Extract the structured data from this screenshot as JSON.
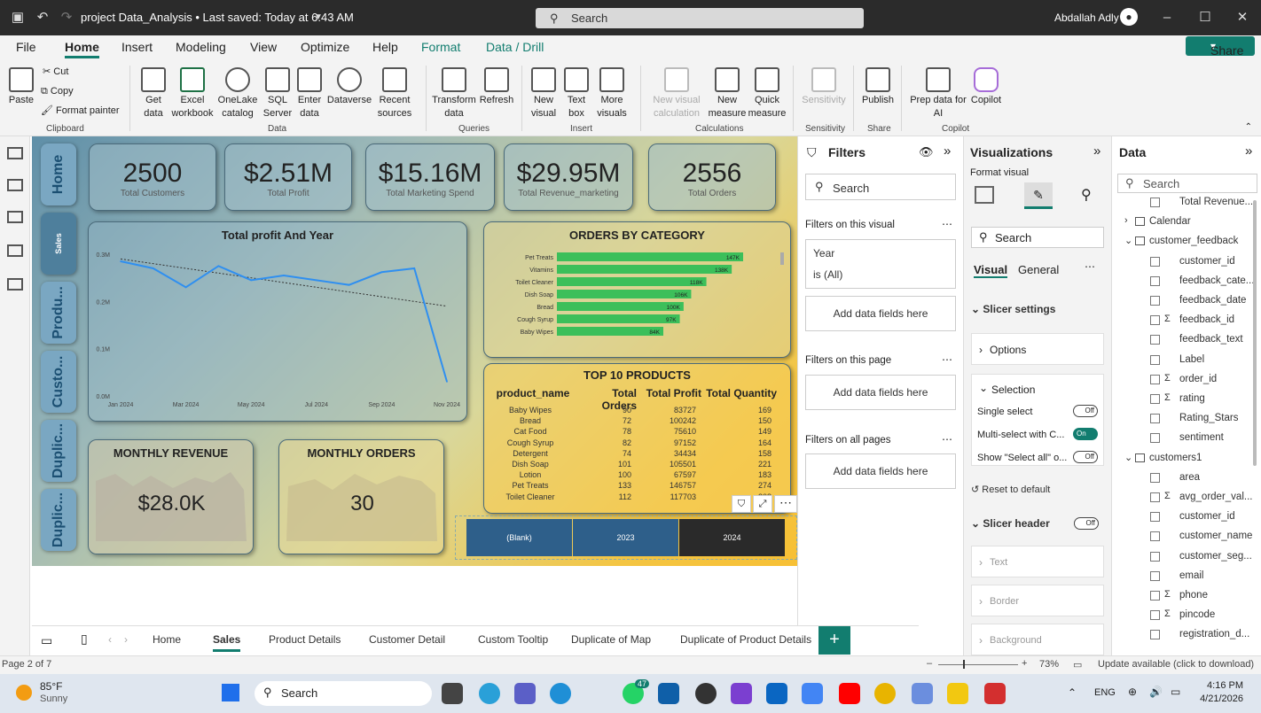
{
  "titlebar": {
    "title": "project Data_Analysis • Last saved: Today at 6:43 AM",
    "search": "Search",
    "user": "Abdallah Adly"
  },
  "menu": [
    "File",
    "Home",
    "Insert",
    "Modeling",
    "View",
    "Optimize",
    "Help",
    "Format",
    "Data / Drill"
  ],
  "share": "Share",
  "ribbon": {
    "clipboard": {
      "paste": "Paste",
      "cut": "Cut",
      "copy": "Copy",
      "format_painter": "Format painter",
      "group": "Clipboard"
    },
    "data": {
      "get_data": "Get data",
      "excel": "Excel workbook",
      "onelake": "OneLake catalog",
      "sql": "SQL Server",
      "enter": "Enter data",
      "dataverse": "Dataverse",
      "recent": "Recent sources",
      "group": "Data"
    },
    "queries": {
      "transform": "Transform data",
      "refresh": "Refresh",
      "group": "Queries"
    },
    "insert": {
      "new_visual": "New visual",
      "text_box": "Text box",
      "more_visuals": "More visuals",
      "group": "Insert"
    },
    "calc": {
      "new_visual_calc": "New visual calculation",
      "new_measure": "New measure",
      "quick_measure": "Quick measure",
      "group": "Calculations"
    },
    "sens": {
      "label": "Sensitivity",
      "group": "Sensitivity"
    },
    "share": {
      "publish": "Publish",
      "group": "Share"
    },
    "copilot": {
      "prep": "Prep data for AI",
      "copilot": "Copilot",
      "group": "Copilot"
    }
  },
  "nav_tabs": [
    "Home",
    "Sales",
    "Produ...",
    "Custo...",
    "Duplic...",
    "Duplic..."
  ],
  "kpis": [
    {
      "value": "2500",
      "label": "Total Customers"
    },
    {
      "value": "$2.51M",
      "label": "Total Profit"
    },
    {
      "value": "$15.16M",
      "label": "Total Marketing Spend"
    },
    {
      "value": "$29.95M",
      "label": "Total Revenue_marketing"
    },
    {
      "value": "2556",
      "label": "Total Orders"
    }
  ],
  "monthly": [
    {
      "title": "MONTHLY REVENUE",
      "value": "$28.0K"
    },
    {
      "title": "MONTHLY ORDERS",
      "value": "30"
    }
  ],
  "chart_data": [
    {
      "type": "line",
      "title": "Total profit And Year",
      "x": [
        "Jan 2024",
        "Feb 2024",
        "Mar 2024",
        "Apr 2024",
        "May 2024",
        "Jun 2024",
        "Jul 2024",
        "Aug 2024",
        "Sep 2024",
        "Oct 2024",
        "Nov 2024"
      ],
      "x_tick_labels": [
        "Jan 2024",
        "Mar 2024",
        "May 2024",
        "Jul 2024",
        "Sep 2024",
        "Nov 2024"
      ],
      "y_tick_labels": [
        "0.0M",
        "0.1M",
        "0.2M",
        "0.3M"
      ],
      "series": [
        {
          "values": [
            0.285,
            0.27,
            0.23,
            0.275,
            0.245,
            0.255,
            0.245,
            0.235,
            0.262,
            0.27,
            0.03
          ]
        }
      ],
      "trendline": [
        0.29,
        0.19
      ],
      "ylim": [
        0,
        0.3
      ]
    },
    {
      "type": "bar",
      "title": "ORDERS BY CATEGORY",
      "categories": [
        "Pet Treats",
        "Vitamins",
        "Toilet Cleaner",
        "Dish Soap",
        "Bread",
        "Cough Syrup",
        "Baby Wipes"
      ],
      "values": [
        147,
        138,
        118,
        106,
        100,
        97,
        84
      ],
      "data_labels": [
        "147K",
        "138K",
        "118K",
        "106K",
        "100K",
        "97K",
        "84K"
      ],
      "xlim": [
        0,
        147
      ],
      "color": "#3cbf5a"
    }
  ],
  "top10": {
    "title": "TOP 10 PRODUCTS",
    "headers": [
      "product_name",
      "Total Orders",
      "Total Profit",
      "Total Quantity"
    ],
    "rows": [
      [
        "Baby Wipes",
        "90",
        "83727",
        "169"
      ],
      [
        "Bread",
        "72",
        "100242",
        "150"
      ],
      [
        "Cat Food",
        "78",
        "75610",
        "149"
      ],
      [
        "Cough Syrup",
        "82",
        "97152",
        "164"
      ],
      [
        "Detergent",
        "74",
        "34434",
        "158"
      ],
      [
        "Dish Soap",
        "101",
        "105501",
        "221"
      ],
      [
        "Lotion",
        "100",
        "67597",
        "183"
      ],
      [
        "Pet Treats",
        "133",
        "146757",
        "274"
      ],
      [
        "Toilet Cleaner",
        "112",
        "117703",
        "208"
      ]
    ]
  },
  "slicer": [
    "(Blank)",
    "2023",
    "2024"
  ],
  "filters": {
    "title": "Filters",
    "search": "Search",
    "on_visual": "Filters on this visual",
    "year_label": "Year",
    "year_value": "is (All)",
    "add": "Add data fields here",
    "on_page": "Filters on this page",
    "on_all": "Filters on all pages"
  },
  "viz": {
    "title": "Visualizations",
    "format_visual": "Format visual",
    "search": "Search",
    "tab_visual": "Visual",
    "tab_general": "General",
    "slicer_settings": "Slicer settings",
    "options": "Options",
    "selection": "Selection",
    "single": "Single select",
    "multi": "Multi-select with C...",
    "show_all": "Show \"Select all\" o...",
    "reset": "Reset to default",
    "slicer_header": "Slicer header",
    "text": "Text",
    "border": "Border",
    "background": "Background",
    "off": "Off",
    "on": "On"
  },
  "data_pane": {
    "title": "Data",
    "search": "Search",
    "items": [
      {
        "name": "Total Revenue...",
        "type": "field"
      },
      {
        "name": "Calendar",
        "type": "table"
      },
      {
        "name": "customer_feedback",
        "type": "table"
      },
      {
        "name": "customer_id",
        "type": "field"
      },
      {
        "name": "feedback_cate...",
        "type": "field"
      },
      {
        "name": "feedback_date",
        "type": "field"
      },
      {
        "name": "feedback_id",
        "type": "sum"
      },
      {
        "name": "feedback_text",
        "type": "field"
      },
      {
        "name": "Label",
        "type": "field"
      },
      {
        "name": "order_id",
        "type": "sum"
      },
      {
        "name": "rating",
        "type": "sum"
      },
      {
        "name": "Rating_Stars",
        "type": "field"
      },
      {
        "name": "sentiment",
        "type": "field"
      },
      {
        "name": "customers1",
        "type": "table"
      },
      {
        "name": "area",
        "type": "field"
      },
      {
        "name": "avg_order_val...",
        "type": "sum"
      },
      {
        "name": "customer_id",
        "type": "field"
      },
      {
        "name": "customer_name",
        "type": "field"
      },
      {
        "name": "customer_seg...",
        "type": "field"
      },
      {
        "name": "email",
        "type": "field"
      },
      {
        "name": "phone",
        "type": "sum"
      },
      {
        "name": "pincode",
        "type": "sum"
      },
      {
        "name": "registration_d...",
        "type": "field"
      }
    ]
  },
  "page_tabs": [
    "Home",
    "Sales",
    "Product Details",
    "Customer Detail",
    "Custom Tooltip",
    "Duplicate of Map",
    "Duplicate of Product Details"
  ],
  "status": {
    "page": "Page 2 of 7",
    "zoom": "73%",
    "update": "Update available (click to download)"
  },
  "taskbar": {
    "temp": "85°F",
    "weather": "Sunny",
    "search": "Search",
    "lang": "ENG",
    "time": "4:16 PM",
    "date": "4/21/2026",
    "badge": "47"
  }
}
